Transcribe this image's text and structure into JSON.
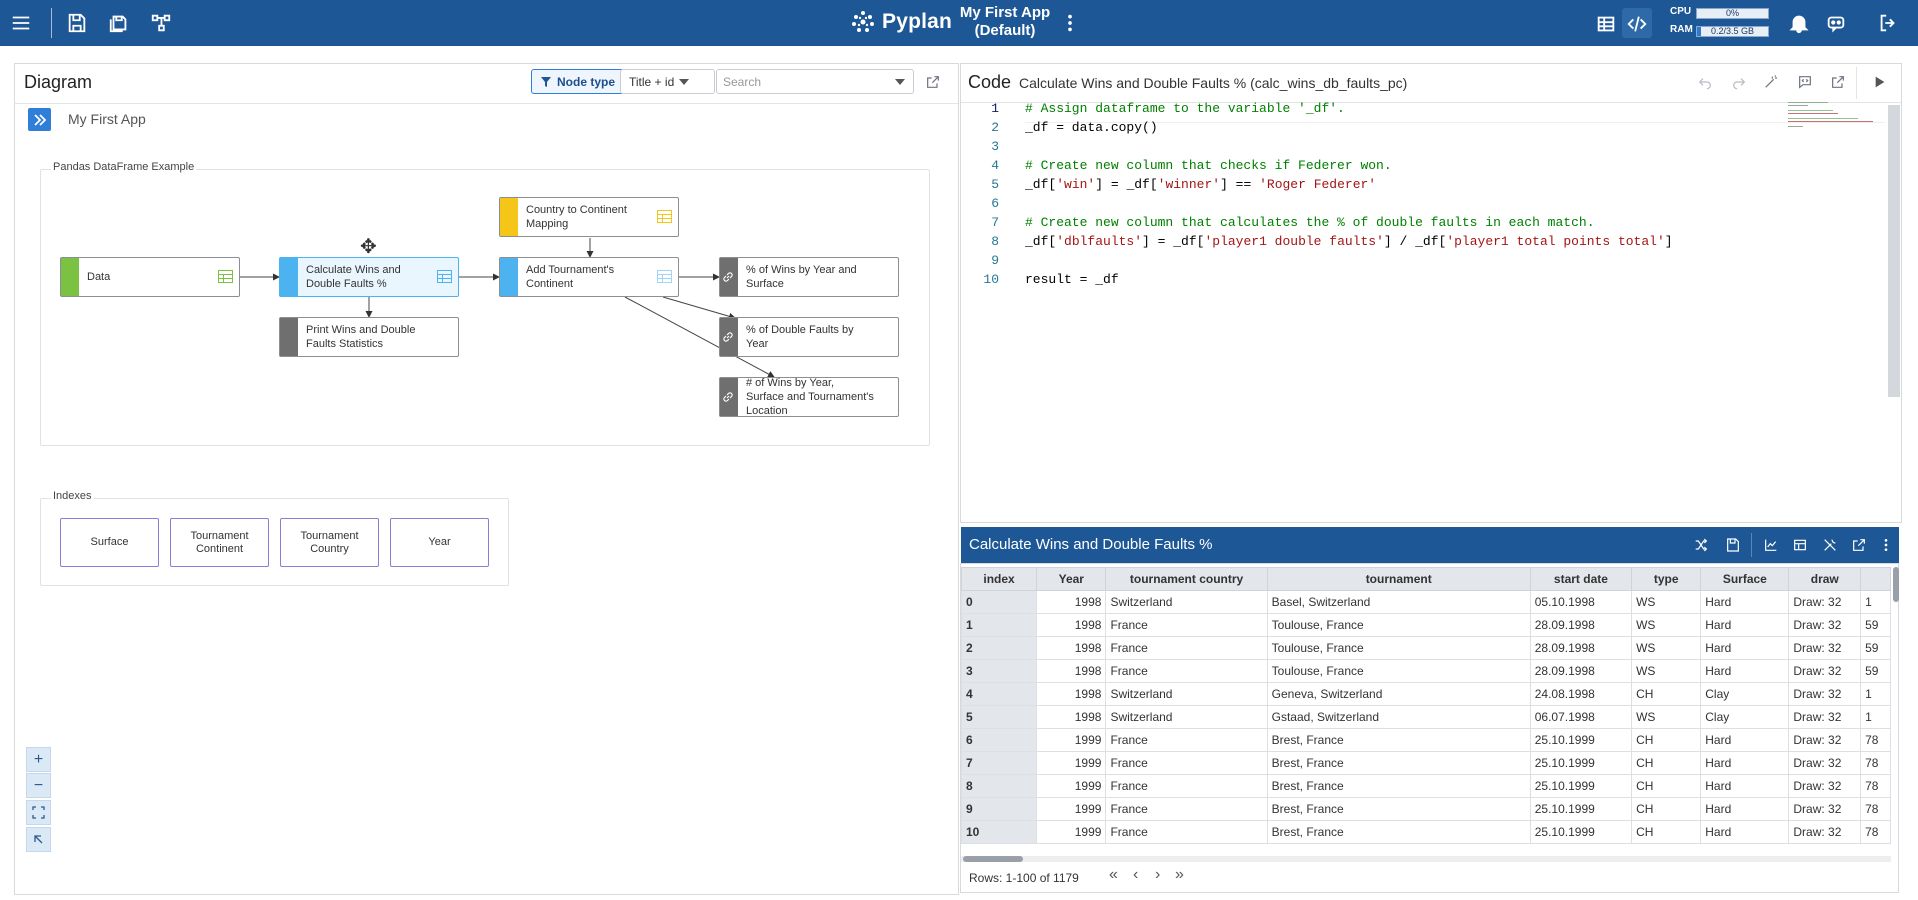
{
  "brand": {
    "name": "Pyplan"
  },
  "app": {
    "title_line1": "My First App",
    "title_line2": "(Default)"
  },
  "resources": {
    "cpu_label": "CPU",
    "cpu_value": "0%",
    "cpu_fraction": 0.0,
    "ram_label": "RAM",
    "ram_value": "0.2/3.5 GB",
    "ram_fraction": 0.06
  },
  "diagram": {
    "title": "Diagram",
    "node_type_label": "Node type",
    "view_label": "Title + id",
    "search_placeholder": "Search",
    "breadcrumb": "My First App",
    "group1_label": "Pandas DataFrame Example",
    "group2_label": "Indexes",
    "nodes": {
      "data": "Data",
      "calc": "Calculate Wins and Double Faults %",
      "country": "Country to Continent Mapping",
      "add": "Add Tournament's Continent",
      "wins": "% of Wins by Year and Surface",
      "print": "Print Wins and Double Faults Statistics",
      "dbl": "% of Double Faults by Year",
      "numwins": "# of Wins by Year, Surface and Tournament's Location"
    },
    "indexes": [
      "Surface",
      "Tournament Continent",
      "Tournament Country",
      "Year"
    ],
    "colors": {
      "data": "#7cc242",
      "calc": "#4cb3f0",
      "country": "#f5c518",
      "add": "#4cb3f0",
      "report": "#6f6f6f"
    }
  },
  "code": {
    "title": "Code",
    "node_title": "Calculate Wins and Double Faults % (calc_wins_db_faults_pc)",
    "lines": [
      {
        "n": "1",
        "html": "<span class=\"cmt\"># Assign dataframe to the variable '_df'.</span>"
      },
      {
        "n": "2",
        "html": "_df = data.copy()"
      },
      {
        "n": "3",
        "html": ""
      },
      {
        "n": "4",
        "html": "<span class=\"cmt\"># Create new column that checks if Federer won.</span>"
      },
      {
        "n": "5",
        "html": "_df[<span class=\"str\">'win'</span>] = _df[<span class=\"str\">'winner'</span>] == <span class=\"str\">'Roger Federer'</span>"
      },
      {
        "n": "6",
        "html": ""
      },
      {
        "n": "7",
        "html": "<span class=\"cmt\"># Create new column that calculates the % of double faults in each match.</span>"
      },
      {
        "n": "8",
        "html": "_df[<span class=\"str\">'dblfaults'</span>] = _df[<span class=\"str\">'player1 double faults'</span>] / _df[<span class=\"str\">'player1 total points total'</span>]"
      },
      {
        "n": "9",
        "html": ""
      },
      {
        "n": "10",
        "html": "result = _df"
      }
    ]
  },
  "table": {
    "title": "Calculate Wins and Double Faults %",
    "columns": [
      "index",
      "Year",
      "tournament country",
      "tournament",
      "start date",
      "type",
      "Surface",
      "draw",
      ""
    ],
    "rows": [
      [
        "0",
        "1998",
        "Switzerland",
        "Basel, Switzerland",
        "05.10.1998",
        "WS",
        "Hard",
        "Draw: 32",
        "1"
      ],
      [
        "1",
        "1998",
        "France",
        "Toulouse, France",
        "28.09.1998",
        "WS",
        "Hard",
        "Draw: 32",
        "59"
      ],
      [
        "2",
        "1998",
        "France",
        "Toulouse, France",
        "28.09.1998",
        "WS",
        "Hard",
        "Draw: 32",
        "59"
      ],
      [
        "3",
        "1998",
        "France",
        "Toulouse, France",
        "28.09.1998",
        "WS",
        "Hard",
        "Draw: 32",
        "59"
      ],
      [
        "4",
        "1998",
        "Switzerland",
        "Geneva, Switzerland",
        "24.08.1998",
        "CH",
        "Clay",
        "Draw: 32",
        "1"
      ],
      [
        "5",
        "1998",
        "Switzerland",
        "Gstaad, Switzerland",
        "06.07.1998",
        "WS",
        "Clay",
        "Draw: 32",
        "1"
      ],
      [
        "6",
        "1999",
        "France",
        "Brest, France",
        "25.10.1999",
        "CH",
        "Hard",
        "Draw: 32",
        "78"
      ],
      [
        "7",
        "1999",
        "France",
        "Brest, France",
        "25.10.1999",
        "CH",
        "Hard",
        "Draw: 32",
        "78"
      ],
      [
        "8",
        "1999",
        "France",
        "Brest, France",
        "25.10.1999",
        "CH",
        "Hard",
        "Draw: 32",
        "78"
      ],
      [
        "9",
        "1999",
        "France",
        "Brest, France",
        "25.10.1999",
        "CH",
        "Hard",
        "Draw: 32",
        "78"
      ],
      [
        "10",
        "1999",
        "France",
        "Brest, France",
        "25.10.1999",
        "CH",
        "Hard",
        "Draw: 32",
        "78"
      ]
    ],
    "rows_info": "Rows: 1-100 of 1179"
  }
}
